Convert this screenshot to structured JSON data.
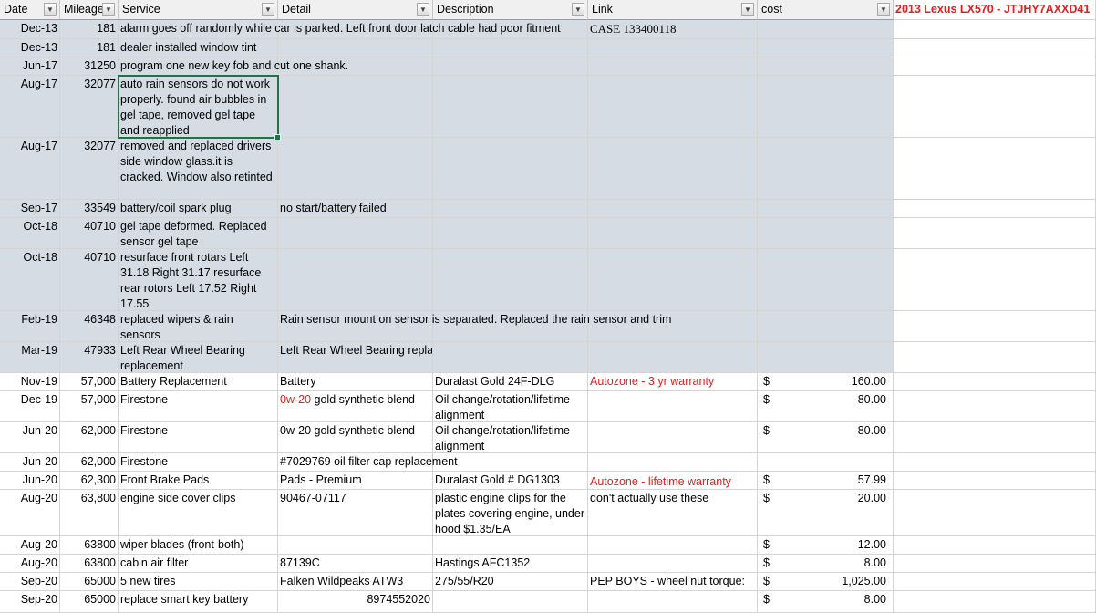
{
  "sheet_title": "2013 Lexus LX570 - JTJHY7AXXD41",
  "filter_icon": "filter-dropdown-icon",
  "colors": {
    "row_fill": "#d6dce4",
    "red_text": "#e0201e",
    "selection": "#217346"
  },
  "headers": {
    "date": "Date",
    "mileage": "Mileage",
    "service": "Service",
    "detail": "Detail",
    "description": "Description",
    "link": "Link",
    "cost": "cost"
  },
  "rows": [
    {
      "date": "Dec-13",
      "mileage": "181",
      "service": " alarm goes off randomly while car is parked. Left front door latch cable had poor fitment",
      "detail": "",
      "description": "",
      "link": "CASE 133400118",
      "cost_sym": "",
      "cost": ""
    },
    {
      "date": "Dec-13",
      "mileage": "181",
      "service": "dealer installed window tint",
      "detail": "",
      "description": "",
      "link": "",
      "cost_sym": "",
      "cost": ""
    },
    {
      "date": "Jun-17",
      "mileage": "31250",
      "service": "program one new key fob and cut one shank.",
      "detail": "",
      "description": "",
      "link": "",
      "cost_sym": "",
      "cost": ""
    },
    {
      "date": "Aug-17",
      "mileage": "32077",
      "service": "auto rain sensors do not work properly. found air bubbles in gel tape, removed gel tape and reapplied",
      "detail": "",
      "description": "",
      "link": "",
      "cost_sym": "",
      "cost": ""
    },
    {
      "date": "Aug-17",
      "mileage": "32077",
      "service": "removed and replaced drivers side window glass.it is cracked. Window also retinted",
      "detail": "",
      "description": "",
      "link": "",
      "cost_sym": "",
      "cost": ""
    },
    {
      "date": "Sep-17",
      "mileage": "33549",
      "service": "battery/coil spark plug",
      "detail": "no start/battery failed",
      "description": "",
      "link": "",
      "cost_sym": "",
      "cost": ""
    },
    {
      "date": "Oct-18",
      "mileage": "40710",
      "service": "gel tape deformed. Replaced sensor gel tape",
      "detail": "",
      "description": "",
      "link": "",
      "cost_sym": "",
      "cost": ""
    },
    {
      "date": "Oct-18",
      "mileage": "40710",
      "service": "resurface front rotars Left 31.18 Right 31.17 resurface rear rotors Left 17.52 Right 17.55",
      "detail": "",
      "description": "",
      "link": "",
      "cost_sym": "",
      "cost": ""
    },
    {
      "date": "Feb-19",
      "mileage": "46348",
      "service": "replaced wipers & rain sensors",
      "detail": "Rain sensor mount on sensor is separated. Replaced the rain sensor and trim",
      "description": "",
      "link": "",
      "cost_sym": "",
      "cost": ""
    },
    {
      "date": "Mar-19",
      "mileage": "47933",
      "service": "Left Rear Wheel Bearing replacement",
      "detail": "Left Rear Wheel Bearing replacement",
      "description": "",
      "link": "",
      "cost_sym": "",
      "cost": ""
    },
    {
      "date": "Nov-19",
      "mileage": "57,000",
      "service": "Battery Replacement",
      "detail": "Battery",
      "description": "Duralast Gold 24F-DLG",
      "link": "Autozone - 3 yr warranty",
      "cost_sym": "$",
      "cost": "160.00"
    },
    {
      "date": "Dec-19",
      "mileage": "57,000",
      "service": "Firestone",
      "detail": "0w-20",
      "detail_rest": " gold synthetic blend",
      "description": "Oil change/rotation/lifetime alignment",
      "link": "",
      "cost_sym": "$",
      "cost": "80.00"
    },
    {
      "date": "Jun-20",
      "mileage": "62,000",
      "service": "Firestone",
      "detail": "0w-20 gold synthetic blend",
      "description": "Oil change/rotation/lifetime alignment",
      "link": "",
      "cost_sym": "$",
      "cost": "80.00"
    },
    {
      "date": "Jun-20",
      "mileage": "62,000",
      "service": "Firestone",
      "detail": "#7029769 oil filter cap replacement",
      "description": "",
      "link": "",
      "cost_sym": "",
      "cost": ""
    },
    {
      "date": "Jun-20",
      "mileage": "62,300",
      "service": "Front Brake Pads",
      "detail": "Pads - Premium",
      "description": "Duralast Gold # DG1303",
      "link": "Autozone - lifetime warranty",
      "cost_sym": "$",
      "cost": "57.99"
    },
    {
      "date": "Aug-20",
      "mileage": "63,800",
      "service": "engine side cover clips",
      "detail": "90467-07117",
      "description": "plastic engine clips for the plates covering engine, under hood $1.35/EA",
      "link": "don't actually use these",
      "cost_sym": "$",
      "cost": "20.00"
    },
    {
      "date": "Aug-20",
      "mileage": "63800",
      "service": "wiper blades (front-both)",
      "detail": "",
      "description": "",
      "link": "",
      "cost_sym": "$",
      "cost": "12.00"
    },
    {
      "date": "Aug-20",
      "mileage": "63800",
      "service": "cabin air filter",
      "detail": "87139C",
      "description": "Hastings AFC1352",
      "link": "",
      "cost_sym": "$",
      "cost": "8.00"
    },
    {
      "date": "Sep-20",
      "mileage": "65000",
      "service": "5 new tires",
      "detail": "Falken Wildpeaks ATW3",
      "description": "275/55/R20",
      "link": "PEP BOYS - wheel nut torque:",
      "cost_sym": "$",
      "cost": "1,025.00"
    },
    {
      "date": "Sep-20",
      "mileage": "65000",
      "service": "replace smart key battery",
      "detail": "8974552020",
      "description": "",
      "link": "",
      "cost_sym": "$",
      "cost": "8.00"
    }
  ]
}
